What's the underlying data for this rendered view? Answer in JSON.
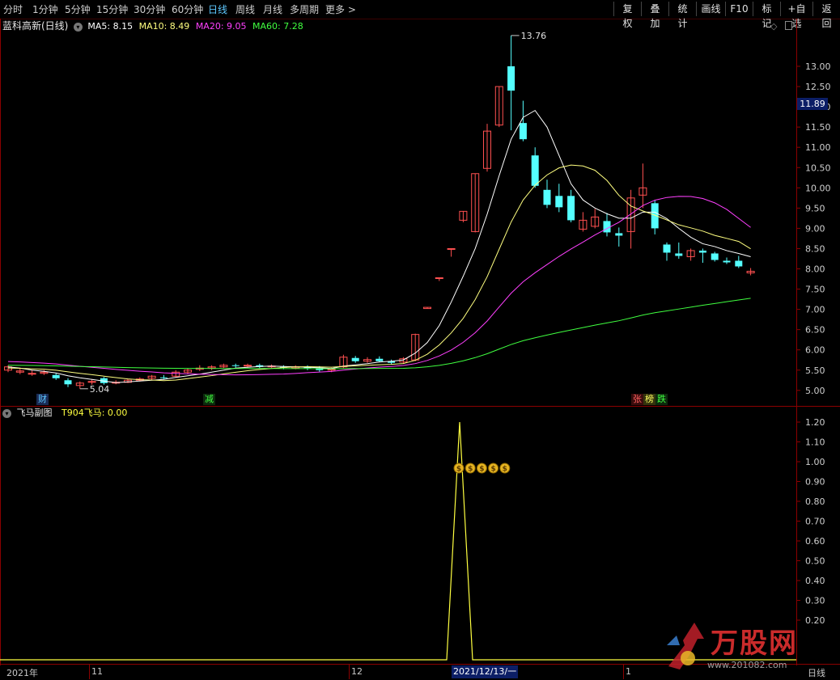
{
  "toolbar": {
    "timeframes": [
      "分时",
      "1分钟",
      "5分钟",
      "15分钟",
      "30分钟",
      "60分钟",
      "日线",
      "周线",
      "月线",
      "多周期",
      "更多 >"
    ],
    "active_timeframe": "日线",
    "buttons": [
      "复权",
      "叠加",
      "统计",
      "画线",
      "F10",
      "标记",
      "+自选",
      "返回"
    ]
  },
  "main_pane": {
    "title": "蓝科高新(日线)",
    "ma": [
      {
        "label": "MA5: 8.15",
        "color": "#ffffff"
      },
      {
        "label": "MA10: 8.49",
        "color": "#ffff80"
      },
      {
        "label": "MA20: 9.05",
        "color": "#ff40ff"
      },
      {
        "label": "MA60: 7.28",
        "color": "#40ff40"
      }
    ],
    "price_ticks": [
      "13.00",
      "12.50",
      "12.00",
      "11.50",
      "11.00",
      "10.50",
      "10.00",
      "9.50",
      "9.00",
      "8.50",
      "8.00",
      "7.50",
      "7.00",
      "6.50",
      "6.00",
      "5.50",
      "5.00"
    ],
    "current_price": "11.89",
    "high_label": "13.76",
    "low_label": "5.04",
    "events": [
      {
        "text": "财",
        "color": "#5ec8ff",
        "bg": "#1a2b55"
      },
      {
        "text": "减",
        "color": "#40ff40",
        "bg": "#0d2a0d"
      },
      {
        "text": "张",
        "color": "#ff6060",
        "bg": "#3a0d0d"
      },
      {
        "text": "榜",
        "color": "#ffff60",
        "bg": "#33330d"
      },
      {
        "text": "跌",
        "color": "#40ff40",
        "bg": "#0d2a0d"
      }
    ]
  },
  "sub_pane": {
    "title": "飞马副图",
    "indicator": "T904飞马: 0.00",
    "ticks": [
      "1.20",
      "1.10",
      "1.00",
      "0.90",
      "0.80",
      "0.70",
      "0.60",
      "0.50",
      "0.40",
      "0.30",
      "0.20"
    ],
    "signal_glyph": "$"
  },
  "time_axis": {
    "labels": [
      "2021年",
      "11",
      "12",
      "2021/12/13/一",
      "1"
    ],
    "period_label": "日线"
  },
  "watermark": {
    "brand": "万股网",
    "url": "www.201082.com"
  },
  "chart_data": {
    "type": "candlestick",
    "title": "蓝科高新(日线)",
    "ylim": [
      4.75,
      13.9
    ],
    "candles": [
      [
        5.5,
        5.58,
        5.62,
        5.45
      ],
      [
        5.45,
        5.48,
        5.55,
        5.4
      ],
      [
        5.4,
        5.42,
        5.5,
        5.36
      ],
      [
        5.42,
        5.45,
        5.5,
        5.38
      ],
      [
        5.38,
        5.3,
        5.42,
        5.26
      ],
      [
        5.25,
        5.15,
        5.3,
        5.08
      ],
      [
        5.12,
        5.18,
        5.22,
        5.04
      ],
      [
        5.2,
        5.22,
        5.28,
        5.14
      ],
      [
        5.3,
        5.18,
        5.33,
        5.14
      ],
      [
        5.18,
        5.2,
        5.25,
        5.15
      ],
      [
        5.2,
        5.25,
        5.28,
        5.18
      ],
      [
        5.25,
        5.28,
        5.32,
        5.22
      ],
      [
        5.3,
        5.35,
        5.38,
        5.26
      ],
      [
        5.32,
        5.3,
        5.38,
        5.28
      ],
      [
        5.35,
        5.45,
        5.5,
        5.32
      ],
      [
        5.45,
        5.5,
        5.55,
        5.4
      ],
      [
        5.52,
        5.55,
        5.62,
        5.48
      ],
      [
        5.55,
        5.58,
        5.62,
        5.5
      ],
      [
        5.58,
        5.62,
        5.66,
        5.55
      ],
      [
        5.62,
        5.6,
        5.66,
        5.56
      ],
      [
        5.6,
        5.62,
        5.66,
        5.56
      ],
      [
        5.62,
        5.58,
        5.66,
        5.55
      ],
      [
        5.58,
        5.6,
        5.64,
        5.55
      ],
      [
        5.58,
        5.56,
        5.62,
        5.52
      ],
      [
        5.55,
        5.58,
        5.62,
        5.52
      ],
      [
        5.58,
        5.55,
        5.62,
        5.5
      ],
      [
        5.55,
        5.5,
        5.6,
        5.46
      ],
      [
        5.5,
        5.52,
        5.56,
        5.45
      ],
      [
        5.58,
        5.82,
        5.88,
        5.55
      ],
      [
        5.8,
        5.72,
        5.85,
        5.68
      ],
      [
        5.72,
        5.76,
        5.82,
        5.68
      ],
      [
        5.78,
        5.72,
        5.84,
        5.7
      ],
      [
        5.72,
        5.68,
        5.76,
        5.64
      ],
      [
        5.7,
        5.78,
        5.82,
        5.66
      ],
      [
        5.75,
        6.38,
        6.4,
        5.72
      ],
      [
        7.02,
        7.05,
        7.05,
        7.02
      ],
      [
        7.76,
        7.78,
        7.78,
        7.7
      ],
      [
        8.48,
        8.5,
        8.5,
        8.3
      ],
      [
        9.2,
        9.42,
        9.42,
        9.15
      ],
      [
        8.92,
        10.35,
        10.35,
        8.9
      ],
      [
        10.48,
        11.4,
        11.58,
        10.4
      ],
      [
        11.55,
        12.5,
        12.5,
        11.5
      ],
      [
        13.0,
        12.4,
        13.76,
        11.42
      ],
      [
        11.6,
        11.2,
        12.15,
        11.15
      ],
      [
        10.8,
        10.05,
        11.0,
        10.0
      ],
      [
        9.95,
        9.58,
        10.2,
        9.5
      ],
      [
        9.8,
        9.52,
        10.1,
        9.4
      ],
      [
        9.8,
        9.2,
        9.95,
        9.15
      ],
      [
        8.98,
        9.2,
        9.4,
        8.92
      ],
      [
        9.05,
        9.28,
        9.48,
        9.0
      ],
      [
        9.18,
        8.9,
        9.38,
        8.8
      ],
      [
        8.88,
        8.82,
        9.02,
        8.55
      ],
      [
        8.92,
        9.75,
        9.95,
        8.5
      ],
      [
        9.82,
        10.0,
        10.6,
        9.5
      ],
      [
        9.62,
        9.0,
        9.7,
        8.85
      ],
      [
        8.6,
        8.4,
        8.65,
        8.2
      ],
      [
        8.38,
        8.32,
        8.65,
        8.25
      ],
      [
        8.3,
        8.45,
        8.5,
        8.2
      ],
      [
        8.45,
        8.4,
        8.5,
        8.15
      ],
      [
        8.38,
        8.22,
        8.42,
        8.18
      ],
      [
        8.2,
        8.16,
        8.28,
        8.12
      ],
      [
        8.2,
        8.06,
        8.32,
        8.02
      ],
      [
        7.9,
        7.94,
        8.02,
        7.84
      ]
    ],
    "ma5": [
      5.58,
      5.55,
      5.5,
      5.47,
      5.43,
      5.36,
      5.31,
      5.27,
      5.23,
      5.19,
      5.21,
      5.23,
      5.25,
      5.27,
      5.32,
      5.36,
      5.4,
      5.45,
      5.5,
      5.55,
      5.57,
      5.59,
      5.6,
      5.59,
      5.58,
      5.57,
      5.56,
      5.54,
      5.6,
      5.63,
      5.66,
      5.7,
      5.72,
      5.75,
      5.92,
      6.18,
      6.6,
      7.18,
      7.82,
      8.5,
      9.35,
      10.3,
      11.2,
      11.74,
      11.91,
      11.5,
      10.8,
      10.1,
      9.7,
      9.5,
      9.36,
      9.25,
      9.25,
      9.4,
      9.4,
      9.24,
      9.0,
      8.78,
      8.62,
      8.55,
      8.45,
      8.38,
      8.3
    ]
  }
}
